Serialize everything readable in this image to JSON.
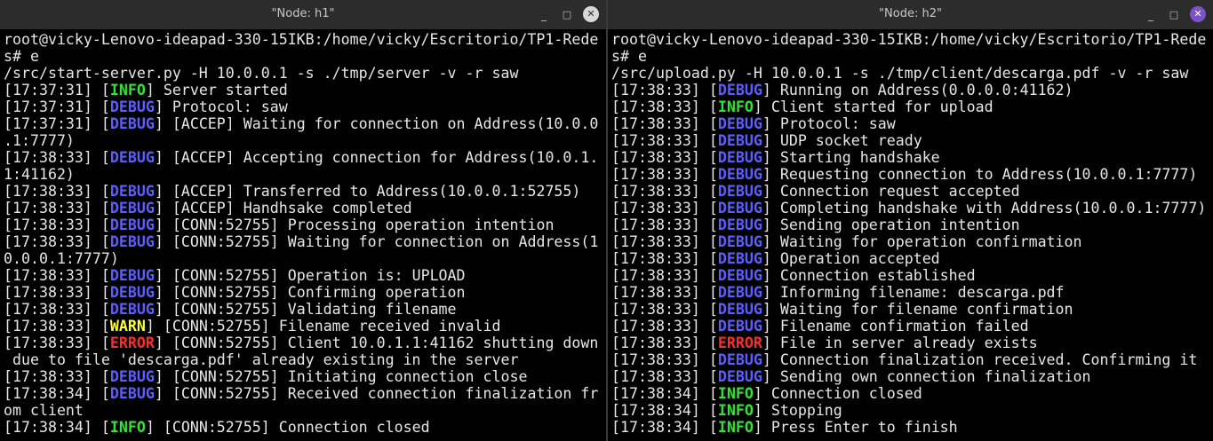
{
  "colors": {
    "terminal_bg": "#000000",
    "text": "#e6e6e6",
    "debug": "#5d5dff",
    "info": "#2ee62e",
    "warn": "#ffff33",
    "error": "#ff2b2b",
    "close_active": "#7b52c8"
  },
  "windows": [
    {
      "title": "\"Node: h1\"",
      "controls": {
        "minimize_icon": "minimize-icon",
        "maximize_icon": "maximize-icon",
        "close_icon": "close-icon",
        "min": "_",
        "max": "□",
        "close": "✕"
      },
      "lines": [
        {
          "text": "root@vicky-Lenovo-ideapad-330-15IKB:/home/vicky/Escritorio/TP1-Rede"
        },
        {
          "text": "s# e                                                                 ."
        },
        {
          "text": "/src/start-server.py -H 10.0.0.1 -s ./tmp/server -v -r saw"
        },
        {
          "ts": "[17:37:31] ",
          "tag": "INFO",
          "msg": " Server started"
        },
        {
          "ts": "[17:37:31] ",
          "tag": "DEBUG",
          "msg": " Protocol: saw"
        },
        {
          "ts": "[17:37:31] ",
          "tag": "DEBUG",
          "msg": " [ACCEP] Waiting for connection on Address(10.0.0"
        },
        {
          "text": ".1:7777)"
        },
        {
          "ts": "[17:38:33] ",
          "tag": "DEBUG",
          "msg": " [ACCEP] Accepting connection for Address(10.0.1."
        },
        {
          "text": "1:41162)"
        },
        {
          "ts": "[17:38:33] ",
          "tag": "DEBUG",
          "msg": " [ACCEP] Transferred to Address(10.0.0.1:52755)"
        },
        {
          "ts": "[17:38:33] ",
          "tag": "DEBUG",
          "msg": " [ACCEP] Handhsake completed"
        },
        {
          "ts": "[17:38:33] ",
          "tag": "DEBUG",
          "msg": " [CONN:52755] Processing operation intention"
        },
        {
          "ts": "[17:38:33] ",
          "tag": "DEBUG",
          "msg": " [CONN:52755] Waiting for connection on Address(1"
        },
        {
          "text": "0.0.0.1:7777)"
        },
        {
          "ts": "[17:38:33] ",
          "tag": "DEBUG",
          "msg": " [CONN:52755] Operation is: UPLOAD"
        },
        {
          "ts": "[17:38:33] ",
          "tag": "DEBUG",
          "msg": " [CONN:52755] Confirming operation"
        },
        {
          "ts": "[17:38:33] ",
          "tag": "DEBUG",
          "msg": " [CONN:52755] Validating filename"
        },
        {
          "ts": "[17:38:33] ",
          "tag": "WARN",
          "msg": " [CONN:52755] Filename received invalid"
        },
        {
          "ts": "[17:38:33] ",
          "tag": "ERROR",
          "msg": " [CONN:52755] Client 10.0.1.1:41162 shutting down"
        },
        {
          "text": " due to file 'descarga.pdf' already existing in the server"
        },
        {
          "ts": "[17:38:33] ",
          "tag": "DEBUG",
          "msg": " [CONN:52755] Initiating connection close"
        },
        {
          "ts": "[17:38:34] ",
          "tag": "DEBUG",
          "msg": " [CONN:52755] Received connection finalization fr"
        },
        {
          "text": "om client"
        },
        {
          "ts": "[17:38:34] ",
          "tag": "INFO",
          "msg": " [CONN:52755] Connection closed"
        },
        {
          "cursor": true
        }
      ]
    },
    {
      "title": "\"Node: h2\"",
      "controls": {
        "minimize_icon": "minimize-icon",
        "maximize_icon": "maximize-icon",
        "close_icon": "close-icon",
        "min": "_",
        "max": "□",
        "close": "✕"
      },
      "lines": [
        {
          "text": "root@vicky-Lenovo-ideapad-330-15IKB:/home/vicky/Escritorio/TP1-Rede"
        },
        {
          "text": "s# e                                                                 ."
        },
        {
          "text": "/src/upload.py -H 10.0.0.1 -s ./tmp/client/descarga.pdf -v -r saw"
        },
        {
          "ts": "[17:38:33] ",
          "tag": "DEBUG",
          "msg": " Running on Address(0.0.0.0:41162)"
        },
        {
          "ts": "[17:38:33] ",
          "tag": "INFO",
          "msg": " Client started for upload"
        },
        {
          "ts": "[17:38:33] ",
          "tag": "DEBUG",
          "msg": " Protocol: saw"
        },
        {
          "ts": "[17:38:33] ",
          "tag": "DEBUG",
          "msg": " UDP socket ready"
        },
        {
          "ts": "[17:38:33] ",
          "tag": "DEBUG",
          "msg": " Starting handshake"
        },
        {
          "ts": "[17:38:33] ",
          "tag": "DEBUG",
          "msg": " Requesting connection to Address(10.0.0.1:7777)"
        },
        {
          "ts": "[17:38:33] ",
          "tag": "DEBUG",
          "msg": " Connection request accepted"
        },
        {
          "ts": "[17:38:33] ",
          "tag": "DEBUG",
          "msg": " Completing handshake with Address(10.0.0.1:7777)"
        },
        {
          "ts": "[17:38:33] ",
          "tag": "DEBUG",
          "msg": " Sending operation intention"
        },
        {
          "ts": "[17:38:33] ",
          "tag": "DEBUG",
          "msg": " Waiting for operation confirmation"
        },
        {
          "ts": "[17:38:33] ",
          "tag": "DEBUG",
          "msg": " Operation accepted"
        },
        {
          "ts": "[17:38:33] ",
          "tag": "DEBUG",
          "msg": " Connection established"
        },
        {
          "ts": "[17:38:33] ",
          "tag": "DEBUG",
          "msg": " Informing filename: descarga.pdf"
        },
        {
          "ts": "[17:38:33] ",
          "tag": "DEBUG",
          "msg": " Waiting for filename confirmation"
        },
        {
          "ts": "[17:38:33] ",
          "tag": "DEBUG",
          "msg": " Filename confirmation failed"
        },
        {
          "ts": "[17:38:33] ",
          "tag": "ERROR",
          "msg": " File in server already exists"
        },
        {
          "ts": "[17:38:33] ",
          "tag": "DEBUG",
          "msg": " Connection finalization received. Confirming it"
        },
        {
          "ts": "[17:38:33] ",
          "tag": "DEBUG",
          "msg": " Sending own connection finalization"
        },
        {
          "ts": "[17:38:34] ",
          "tag": "INFO",
          "msg": " Connection closed"
        },
        {
          "ts": "[17:38:34] ",
          "tag": "INFO",
          "msg": " Stopping"
        },
        {
          "ts": "[17:38:34] ",
          "tag": "INFO",
          "msg": " Press Enter to finish"
        },
        {
          "cursor": true
        }
      ]
    }
  ]
}
